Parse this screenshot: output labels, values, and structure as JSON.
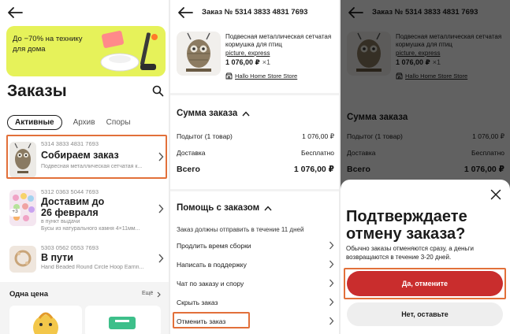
{
  "orders_screen": {
    "banner_text": "До −70% на технику для дома",
    "title": "Заказы",
    "tabs": [
      "Активные",
      "Архив",
      "Споры"
    ],
    "orders": [
      {
        "number": "5314 3833 4831 7693",
        "status": "Собираем заказ",
        "description": "Подвесная металлическая сетчатая к..."
      },
      {
        "number": "5312 0363 5044 7693",
        "status": "Доставим до 26 февраля",
        "status_line1": "Доставим до",
        "status_line2": "26 февраля",
        "sub": "в пункт выдачи",
        "description": "Бусы из натурального камня 4×11мм...",
        "badge": "+3"
      },
      {
        "number": "5303 0562 0553 7693",
        "status": "В пути",
        "description": "Hand Beaded Round Circle Hoop Earrin..."
      }
    ],
    "section": {
      "title": "Одна цена",
      "link": "Ещё"
    }
  },
  "order_screen": {
    "header": "Заказ № 5314 3833 4831 7693",
    "product": {
      "name": "Подвесная металлическая сетчатая кормушка для птиц",
      "tags": "picture, express",
      "price": "1 076,00 ₽",
      "qty": "×1",
      "store": "Hallo Home Store Store"
    },
    "sum": {
      "title": "Сумма заказа",
      "rows": [
        {
          "label": "Подытог (1 товар)",
          "value": "1 076,00 ₽"
        },
        {
          "label": "Доставка",
          "value": "Бесплатно"
        }
      ],
      "total_label": "Всего",
      "total_value": "1 076,00 ₽"
    },
    "help": {
      "title": "Помощь с заказом",
      "note": "Заказ должны отправить в течение 11 дней",
      "items": [
        "Продлить время сборки",
        "Написать в поддержку",
        "Чат по заказу и спору",
        "Скрыть заказ",
        "Отменить заказ"
      ]
    }
  },
  "cancel_dialog": {
    "title": "Подтверждаете отмену заказа?",
    "text": "Обычно заказы отменяются сразу, а деньги возвращаются в течение 3-20 дней.",
    "confirm": "Да, отмените",
    "dismiss": "Нет, оставьте"
  },
  "colors": {
    "accent_red": "#c92d2d",
    "highlight": "#e2703a",
    "banner": "#e6f25a"
  }
}
